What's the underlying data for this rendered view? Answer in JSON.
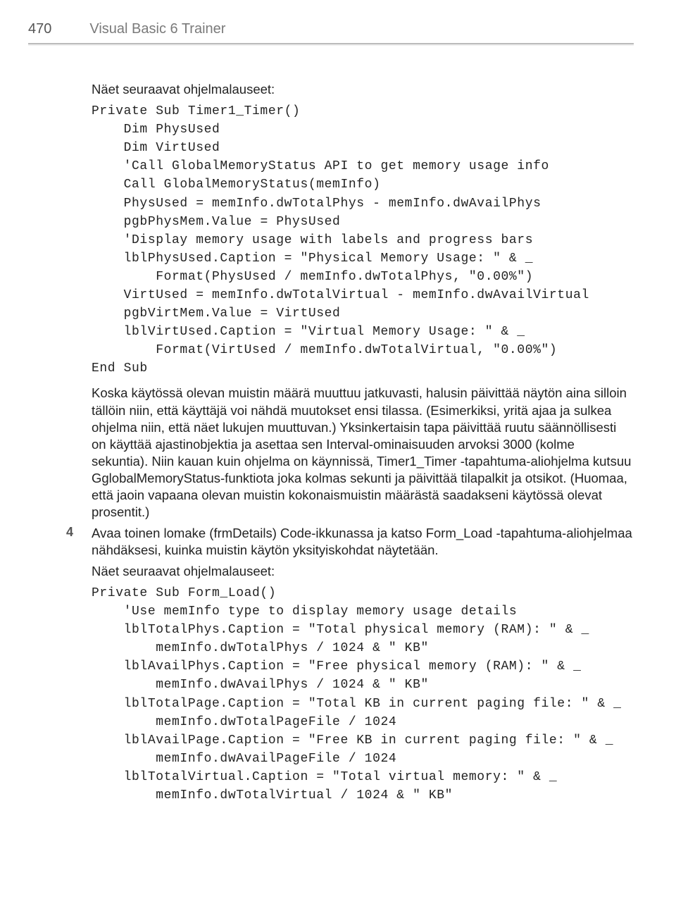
{
  "header": {
    "page_number": "470",
    "title": "Visual Basic 6 Trainer"
  },
  "section1": {
    "intro": "Näet seuraavat ohjelmalauseet:",
    "code": "Private Sub Timer1_Timer()\n    Dim PhysUsed\n    Dim VirtUsed\n    'Call GlobalMemoryStatus API to get memory usage info\n    Call GlobalMemoryStatus(memInfo)\n    PhysUsed = memInfo.dwTotalPhys - memInfo.dwAvailPhys\n    pgbPhysMem.Value = PhysUsed\n    'Display memory usage with labels and progress bars\n    lblPhysUsed.Caption = \"Physical Memory Usage: \" & _\n        Format(PhysUsed / memInfo.dwTotalPhys, \"0.00%\")\n    VirtUsed = memInfo.dwTotalVirtual - memInfo.dwAvailVirtual\n    pgbVirtMem.Value = VirtUsed\n    lblVirtUsed.Caption = \"Virtual Memory Usage: \" & _\n        Format(VirtUsed / memInfo.dwTotalVirtual, \"0.00%\")\nEnd Sub",
    "para": "Koska käytössä olevan muistin määrä muuttuu jatkuvasti, halusin päivittää näytön aina silloin tällöin niin, että käyttäjä voi nähdä muutokset ensi tilassa. (Esimerkiksi, yritä ajaa ja sulkea ohjelma niin, että näet lukujen muuttuvan.) Yksinkertaisin tapa päivittää ruutu säännöllisesti on käyttää ajastinobjektia ja asettaa sen Interval-ominaisuuden arvoksi 3000 (kolme sekuntia). Niin kauan kuin ohjelma on käynnissä, Timer1_Timer -tapahtuma-aliohjelma kutsuu GglobalMemoryStatus-funktiota joka kolmas sekunti ja päivittää tilapalkit ja otsikot. (Huomaa, että jaoin vapaana olevan muistin kokonaismuistin määrästä saadakseni käytössä olevat prosentit.)"
  },
  "step4": {
    "num": "4",
    "text": "Avaa toinen lomake (frmDetails) Code-ikkunassa ja katso Form_Load -tapahtuma-aliohjelmaa nähdäksesi, kuinka muistin käytön yksityiskohdat näytetään.",
    "intro2": "Näet seuraavat ohjelmalauseet:",
    "code": "Private Sub Form_Load()\n    'Use memInfo type to display memory usage details\n    lblTotalPhys.Caption = \"Total physical memory (RAM): \" & _\n        memInfo.dwTotalPhys / 1024 & \" KB\"\n    lblAvailPhys.Caption = \"Free physical memory (RAM): \" & _\n        memInfo.dwAvailPhys / 1024 & \" KB\"\n    lblTotalPage.Caption = \"Total KB in current paging file: \" & _\n        memInfo.dwTotalPageFile / 1024\n    lblAvailPage.Caption = \"Free KB in current paging file: \" & _\n        memInfo.dwAvailPageFile / 1024\n    lblTotalVirtual.Caption = \"Total virtual memory: \" & _\n        memInfo.dwTotalVirtual / 1024 & \" KB\""
  }
}
